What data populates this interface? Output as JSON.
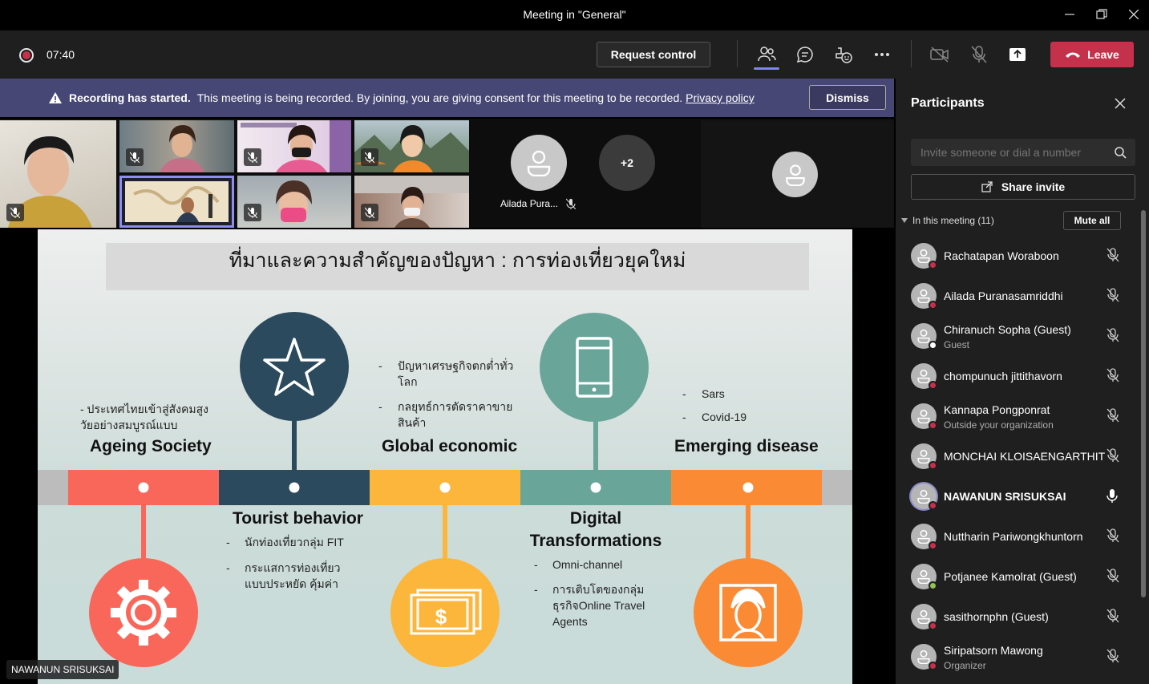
{
  "window": {
    "title": "Meeting in \"General\""
  },
  "toolbar": {
    "timer": "07:40",
    "request_control": "Request control",
    "leave": "Leave"
  },
  "banner": {
    "heading": "Recording has started.",
    "message": "This meeting is being recorded. By joining, you are giving consent for this meeting to be recorded.",
    "link": "Privacy policy",
    "dismiss": "Dismiss"
  },
  "gallery": {
    "named_tile": "Ailada Pura...",
    "overflow_count": "+2"
  },
  "speaker_label": "NAWANUN SRISUKSAI",
  "slide": {
    "title": "ที่มาและความสำคัญของปัญหา : การท่องเที่ยวยุคใหม่",
    "ageing": {
      "label": "Ageing Society",
      "bullet": "- ประเทศไทยเข้าสู่สังคมสูงวัยอย่างสมบูรณ์แบบ"
    },
    "global": {
      "label": "Global economic",
      "bullets": [
        "ปัญหาเศรษฐกิจตกต่ำทั่วโลก",
        "กลยุทธ์การตัดราคาขายสินค้า"
      ]
    },
    "emerging": {
      "label": "Emerging disease",
      "bullets": [
        "Sars",
        "Covid-19"
      ]
    },
    "tourist": {
      "label": "Tourist behavior",
      "bullets": [
        "นักท่องเที่ยวกลุ่ม FIT",
        "กระแสการท่องเที่ยวแบบประหยัด คุ้มค่า"
      ]
    },
    "digital": {
      "label_line1": "Digital",
      "label_line2": "Transformations",
      "bullets": [
        "Omni-channel",
        "การเติบโตของกลุ่มธุรกิจOnline Travel Agents"
      ]
    },
    "colors": {
      "coral": "#f9675a",
      "navy": "#2c4a5e",
      "amber": "#fcb63c",
      "teal": "#6aa59a",
      "orange": "#fb8a35",
      "gray": "#bcbcbc"
    }
  },
  "panel": {
    "title": "Participants",
    "invite_placeholder": "Invite someone or dial a number",
    "share_invite": "Share invite",
    "section": "In this meeting (11)",
    "mute_all": "Mute all",
    "participants": [
      {
        "name": "Rachatapan Woraboon",
        "sub": "",
        "status": "busy",
        "mic": "muted"
      },
      {
        "name": "Ailada Puranasamriddhi",
        "sub": "",
        "status": "busy",
        "mic": "muted"
      },
      {
        "name": "Chiranuch Sopha (Guest)",
        "sub": "Guest",
        "status": "offline",
        "mic": "muted"
      },
      {
        "name": "chompunuch jittithavorn",
        "sub": "",
        "status": "busy",
        "mic": "muted"
      },
      {
        "name": "Kannapa Pongponrat",
        "sub": "Outside your organization",
        "status": "busy",
        "mic": "muted"
      },
      {
        "name": "MONCHAI KLOISAENGARTHIT",
        "sub": "",
        "status": "busy",
        "mic": "muted"
      },
      {
        "name": "NAWANUN SRISUKSAI",
        "sub": "",
        "status": "busy",
        "mic": "on"
      },
      {
        "name": "Nuttharin Pariwongkhuntorn",
        "sub": "",
        "status": "busy",
        "mic": "muted"
      },
      {
        "name": "Potjanee Kamolrat (Guest)",
        "sub": "",
        "status": "available",
        "mic": "muted"
      },
      {
        "name": "sasithornphn (Guest)",
        "sub": "",
        "status": "busy",
        "mic": "muted"
      },
      {
        "name": "Siripatsorn Mawong",
        "sub": "Organizer",
        "status": "busy",
        "mic": "muted"
      }
    ]
  }
}
